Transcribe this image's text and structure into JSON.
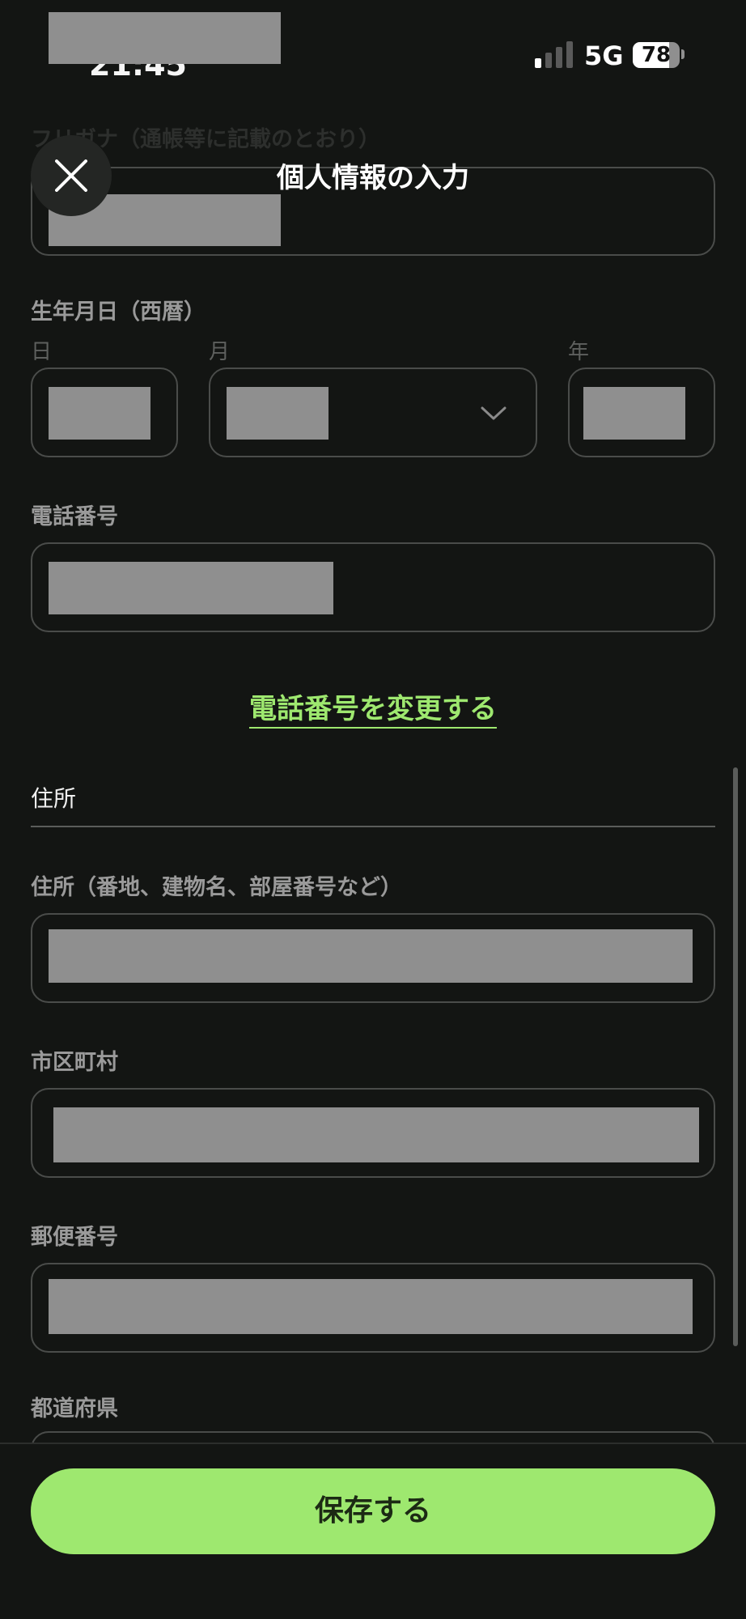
{
  "status_bar": {
    "time_partial": "21:45",
    "network": "5G",
    "battery": 78
  },
  "header": {
    "title": "個人情報の入力",
    "close_icon": "close-icon"
  },
  "partial_field_label": "フリガナ（通帳等に記載のとおり）",
  "birthdate": {
    "label": "生年月日（西暦）",
    "day_label": "日",
    "month_label": "月",
    "year_label": "年"
  },
  "phone": {
    "label": "電話番号",
    "change_link": "電話番号を変更する"
  },
  "address_section": {
    "title": "住所",
    "street_label": "住所（番地、建物名、部屋番号など）",
    "city_label": "市区町村",
    "postal_label": "郵便番号",
    "prefecture_label": "都道府県"
  },
  "save_label": "保存する",
  "colors": {
    "background": "#131513",
    "accent": "#9ee86f",
    "field_border": "#4a4c4a",
    "redaction": "#8f8f8f"
  }
}
